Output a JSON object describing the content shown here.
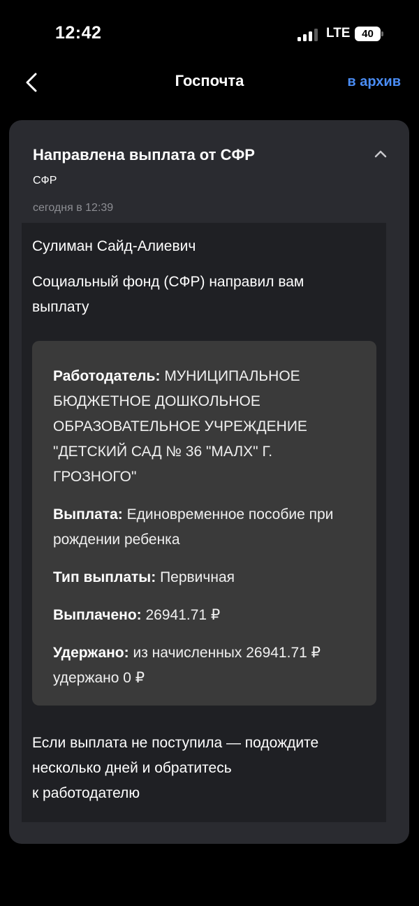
{
  "status_bar": {
    "time": "12:42",
    "network": "LTE",
    "battery": "40",
    "signal_bars_active": 3
  },
  "nav": {
    "title": "Госпочта",
    "archive_label": "в архив",
    "back_icon": "chevron-left-icon",
    "accent_color": "#4a8df5"
  },
  "message": {
    "title": "Направлена выплата от СФР",
    "sender": "СФР",
    "date": "сегодня в 12:39",
    "collapse_icon": "chevron-up-icon",
    "recipient": "Сулиман Сайд-Алиевич",
    "intro": "Социальный фонд (СФР) направил вам выплату",
    "details": [
      {
        "label": "Работодатель:",
        "value": "МУНИЦИПАЛЬНОЕ БЮДЖЕТНОЕ ДОШКОЛЬНОЕ ОБРАЗОВАТЕЛЬНОЕ УЧРЕЖДЕНИЕ \"ДЕТСКИЙ САД № 36 \"МАЛХ\" Г. ГРОЗНОГО\""
      },
      {
        "label": "Выплата:",
        "value": "Единовременное пособие при рождении ребенка"
      },
      {
        "label": "Тип выплаты:",
        "value": "Первичная"
      },
      {
        "label": "Выплачено:",
        "value": "26941.71 ₽"
      },
      {
        "label": "Удержано:",
        "value": "из начисленных 26941.71 ₽ удержано 0 ₽"
      }
    ],
    "footer_line1": "Если выплата не поступила — подождите",
    "footer_line2": "несколько дней и обратитесь",
    "footer_line3": "к работодателю"
  }
}
